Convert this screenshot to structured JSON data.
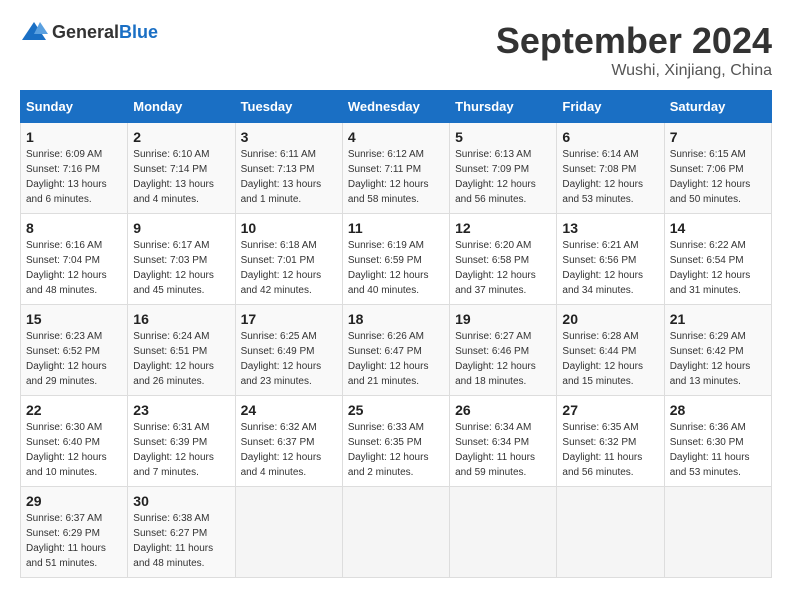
{
  "header": {
    "logo_general": "General",
    "logo_blue": "Blue",
    "month": "September 2024",
    "location": "Wushi, Xinjiang, China"
  },
  "weekdays": [
    "Sunday",
    "Monday",
    "Tuesday",
    "Wednesday",
    "Thursday",
    "Friday",
    "Saturday"
  ],
  "weeks": [
    [
      {
        "day": "1",
        "sunrise": "Sunrise: 6:09 AM",
        "sunset": "Sunset: 7:16 PM",
        "daylight": "Daylight: 13 hours and 6 minutes."
      },
      {
        "day": "2",
        "sunrise": "Sunrise: 6:10 AM",
        "sunset": "Sunset: 7:14 PM",
        "daylight": "Daylight: 13 hours and 4 minutes."
      },
      {
        "day": "3",
        "sunrise": "Sunrise: 6:11 AM",
        "sunset": "Sunset: 7:13 PM",
        "daylight": "Daylight: 13 hours and 1 minute."
      },
      {
        "day": "4",
        "sunrise": "Sunrise: 6:12 AM",
        "sunset": "Sunset: 7:11 PM",
        "daylight": "Daylight: 12 hours and 58 minutes."
      },
      {
        "day": "5",
        "sunrise": "Sunrise: 6:13 AM",
        "sunset": "Sunset: 7:09 PM",
        "daylight": "Daylight: 12 hours and 56 minutes."
      },
      {
        "day": "6",
        "sunrise": "Sunrise: 6:14 AM",
        "sunset": "Sunset: 7:08 PM",
        "daylight": "Daylight: 12 hours and 53 minutes."
      },
      {
        "day": "7",
        "sunrise": "Sunrise: 6:15 AM",
        "sunset": "Sunset: 7:06 PM",
        "daylight": "Daylight: 12 hours and 50 minutes."
      }
    ],
    [
      {
        "day": "8",
        "sunrise": "Sunrise: 6:16 AM",
        "sunset": "Sunset: 7:04 PM",
        "daylight": "Daylight: 12 hours and 48 minutes."
      },
      {
        "day": "9",
        "sunrise": "Sunrise: 6:17 AM",
        "sunset": "Sunset: 7:03 PM",
        "daylight": "Daylight: 12 hours and 45 minutes."
      },
      {
        "day": "10",
        "sunrise": "Sunrise: 6:18 AM",
        "sunset": "Sunset: 7:01 PM",
        "daylight": "Daylight: 12 hours and 42 minutes."
      },
      {
        "day": "11",
        "sunrise": "Sunrise: 6:19 AM",
        "sunset": "Sunset: 6:59 PM",
        "daylight": "Daylight: 12 hours and 40 minutes."
      },
      {
        "day": "12",
        "sunrise": "Sunrise: 6:20 AM",
        "sunset": "Sunset: 6:58 PM",
        "daylight": "Daylight: 12 hours and 37 minutes."
      },
      {
        "day": "13",
        "sunrise": "Sunrise: 6:21 AM",
        "sunset": "Sunset: 6:56 PM",
        "daylight": "Daylight: 12 hours and 34 minutes."
      },
      {
        "day": "14",
        "sunrise": "Sunrise: 6:22 AM",
        "sunset": "Sunset: 6:54 PM",
        "daylight": "Daylight: 12 hours and 31 minutes."
      }
    ],
    [
      {
        "day": "15",
        "sunrise": "Sunrise: 6:23 AM",
        "sunset": "Sunset: 6:52 PM",
        "daylight": "Daylight: 12 hours and 29 minutes."
      },
      {
        "day": "16",
        "sunrise": "Sunrise: 6:24 AM",
        "sunset": "Sunset: 6:51 PM",
        "daylight": "Daylight: 12 hours and 26 minutes."
      },
      {
        "day": "17",
        "sunrise": "Sunrise: 6:25 AM",
        "sunset": "Sunset: 6:49 PM",
        "daylight": "Daylight: 12 hours and 23 minutes."
      },
      {
        "day": "18",
        "sunrise": "Sunrise: 6:26 AM",
        "sunset": "Sunset: 6:47 PM",
        "daylight": "Daylight: 12 hours and 21 minutes."
      },
      {
        "day": "19",
        "sunrise": "Sunrise: 6:27 AM",
        "sunset": "Sunset: 6:46 PM",
        "daylight": "Daylight: 12 hours and 18 minutes."
      },
      {
        "day": "20",
        "sunrise": "Sunrise: 6:28 AM",
        "sunset": "Sunset: 6:44 PM",
        "daylight": "Daylight: 12 hours and 15 minutes."
      },
      {
        "day": "21",
        "sunrise": "Sunrise: 6:29 AM",
        "sunset": "Sunset: 6:42 PM",
        "daylight": "Daylight: 12 hours and 13 minutes."
      }
    ],
    [
      {
        "day": "22",
        "sunrise": "Sunrise: 6:30 AM",
        "sunset": "Sunset: 6:40 PM",
        "daylight": "Daylight: 12 hours and 10 minutes."
      },
      {
        "day": "23",
        "sunrise": "Sunrise: 6:31 AM",
        "sunset": "Sunset: 6:39 PM",
        "daylight": "Daylight: 12 hours and 7 minutes."
      },
      {
        "day": "24",
        "sunrise": "Sunrise: 6:32 AM",
        "sunset": "Sunset: 6:37 PM",
        "daylight": "Daylight: 12 hours and 4 minutes."
      },
      {
        "day": "25",
        "sunrise": "Sunrise: 6:33 AM",
        "sunset": "Sunset: 6:35 PM",
        "daylight": "Daylight: 12 hours and 2 minutes."
      },
      {
        "day": "26",
        "sunrise": "Sunrise: 6:34 AM",
        "sunset": "Sunset: 6:34 PM",
        "daylight": "Daylight: 11 hours and 59 minutes."
      },
      {
        "day": "27",
        "sunrise": "Sunrise: 6:35 AM",
        "sunset": "Sunset: 6:32 PM",
        "daylight": "Daylight: 11 hours and 56 minutes."
      },
      {
        "day": "28",
        "sunrise": "Sunrise: 6:36 AM",
        "sunset": "Sunset: 6:30 PM",
        "daylight": "Daylight: 11 hours and 53 minutes."
      }
    ],
    [
      {
        "day": "29",
        "sunrise": "Sunrise: 6:37 AM",
        "sunset": "Sunset: 6:29 PM",
        "daylight": "Daylight: 11 hours and 51 minutes."
      },
      {
        "day": "30",
        "sunrise": "Sunrise: 6:38 AM",
        "sunset": "Sunset: 6:27 PM",
        "daylight": "Daylight: 11 hours and 48 minutes."
      },
      null,
      null,
      null,
      null,
      null
    ]
  ]
}
